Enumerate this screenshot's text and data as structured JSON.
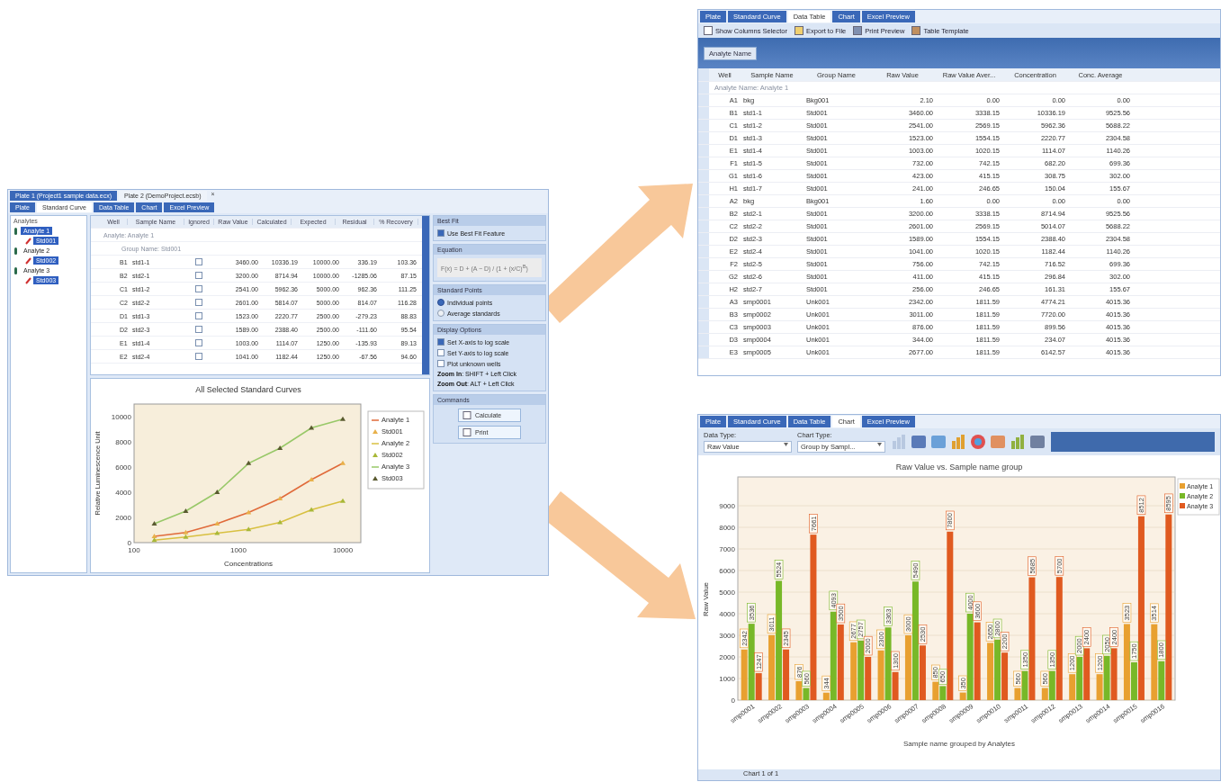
{
  "standard_curve_window": {
    "doc_tabs": [
      {
        "label": "Plate 1 (Project1 sample data.ecx)",
        "selected": true
      },
      {
        "label": "Plate 2 (DemoProject.ecsb)",
        "selected": false
      }
    ],
    "close_glyph": "×",
    "view_tabs": [
      {
        "label": "Plate",
        "selected": false
      },
      {
        "label": "Standard Curve",
        "selected": true
      },
      {
        "label": "Data Table",
        "selected": false
      },
      {
        "label": "Chart",
        "selected": false
      },
      {
        "label": "Excel Preview",
        "selected": false
      }
    ],
    "analytes_panel": {
      "title": "Analytes",
      "tree": [
        {
          "label": "Analyte 1",
          "selected": true,
          "children": [
            {
              "label": "Std001",
              "selected": true
            }
          ]
        },
        {
          "label": "Analyte 2",
          "selected": false,
          "children": [
            {
              "label": "Std002",
              "selected": true
            }
          ]
        },
        {
          "label": "Analyte 3",
          "selected": false,
          "children": [
            {
              "label": "Std003",
              "selected": true
            }
          ]
        }
      ]
    },
    "grid": {
      "columns": [
        "Well",
        "Sample Name",
        "Ignored",
        "Raw Value",
        "Calculated",
        "Expected",
        "Residual",
        "% Recovery"
      ],
      "group_rows": [
        "Analyte: Analyte 1",
        "Group Name: Std001"
      ],
      "rows": [
        {
          "well": "B1",
          "sample": "std1-1",
          "ignored": false,
          "values": [
            "3460.00",
            "10336.19",
            "10000.00",
            "336.19",
            "103.36"
          ]
        },
        {
          "well": "B2",
          "sample": "std2-1",
          "ignored": false,
          "values": [
            "3200.00",
            "8714.94",
            "10000.00",
            "-1285.06",
            "87.15"
          ]
        },
        {
          "well": "C1",
          "sample": "std1-2",
          "ignored": false,
          "values": [
            "2541.00",
            "5962.36",
            "5000.00",
            "962.36",
            "111.25"
          ]
        },
        {
          "well": "C2",
          "sample": "std2-2",
          "ignored": false,
          "values": [
            "2601.00",
            "5814.07",
            "5000.00",
            "814.07",
            "116.28"
          ]
        },
        {
          "well": "D1",
          "sample": "std1-3",
          "ignored": false,
          "values": [
            "1523.00",
            "2220.77",
            "2500.00",
            "-279.23",
            "88.83"
          ]
        },
        {
          "well": "D2",
          "sample": "std2-3",
          "ignored": false,
          "values": [
            "1589.00",
            "2388.40",
            "2500.00",
            "-111.60",
            "95.54"
          ]
        },
        {
          "well": "E1",
          "sample": "std1-4",
          "ignored": false,
          "values": [
            "1003.00",
            "1114.07",
            "1250.00",
            "-135.93",
            "89.13"
          ]
        },
        {
          "well": "E2",
          "sample": "std2-4",
          "ignored": false,
          "values": [
            "1041.00",
            "1182.44",
            "1250.00",
            "-67.56",
            "94.60"
          ]
        }
      ]
    },
    "curve_chart": {
      "chart_data": {
        "type": "line",
        "title": "All Selected Standard Curves",
        "xlabel": "Concentrations",
        "ylabel": "Relative Luminescence Unit",
        "categories": [
          null,
          null,
          null,
          null,
          null,
          null,
          null
        ],
        "legend": "right",
        "ylim": [
          0,
          11000
        ],
        "yticks": [
          0,
          2000,
          4000,
          6000,
          8000,
          10000
        ],
        "series": [
          {
            "name": "Analyte 1",
            "type": "line",
            "color": "#e06a3a",
            "values": [
              500,
              800,
              1500,
              2400,
              3500,
              5000,
              6300
            ]
          },
          {
            "name": "Std001",
            "type": "scatter",
            "color": "#e8b04a",
            "values": [
              500,
              800,
              1500,
              2400,
              3500,
              5000,
              6300
            ]
          },
          {
            "name": "Analyte 2",
            "type": "line",
            "color": "#d8c040",
            "values": [
              200,
              450,
              750,
              1050,
              1600,
              2600,
              3300
            ]
          },
          {
            "name": "Std002",
            "type": "scatter",
            "color": "#a8b838",
            "values": [
              200,
              450,
              750,
              1050,
              1600,
              2600,
              3300
            ]
          },
          {
            "name": "Analyte 3",
            "type": "line",
            "color": "#98c868",
            "values": [
              1500,
              2500,
              4000,
              6300,
              7500,
              9100,
              9800
            ]
          },
          {
            "name": "Std003",
            "type": "scatter",
            "color": "#5a5a30",
            "values": [
              1500,
              2500,
              4000,
              6300,
              7500,
              9100,
              9800
            ]
          }
        ]
      },
      "x_axis_labels": [
        "100",
        "1000",
        "10000"
      ]
    },
    "panels": [
      {
        "title": "Best Fit",
        "kind": "checks",
        "items": [
          {
            "label": "Use Best Fit Feature",
            "checked": true
          }
        ]
      },
      {
        "title": "Equation",
        "kind": "equation",
        "equation": "F(x) = D + (A − D) / (1 + (x/C)$^{B}$)"
      },
      {
        "title": "Standard Points",
        "kind": "radios",
        "items": [
          {
            "label": "Individual points",
            "selected": true
          },
          {
            "label": "Average standards",
            "selected": false
          }
        ]
      },
      {
        "title": "Display Options",
        "kind": "checks",
        "items": [
          {
            "label": "Set X-axis to log scale",
            "checked": true
          },
          {
            "label": "Set Y-axis to log scale",
            "checked": false
          },
          {
            "label": "Plot unknown wells",
            "checked": false
          }
        ],
        "notes": [
          "**Zoom In**: SHIFT + Left Click",
          "**Zoom Out**: ALT + Left Click"
        ]
      },
      {
        "title": "Commands",
        "kind": "buttons",
        "buttons": [
          "Calculate",
          "Print"
        ]
      }
    ]
  },
  "data_table_window": {
    "tabs": [
      {
        "label": "Plate",
        "selected": false
      },
      {
        "label": "Standard Curve",
        "selected": false
      },
      {
        "label": "Data Table",
        "selected": true
      },
      {
        "label": "Chart",
        "selected": false
      },
      {
        "label": "Excel Preview",
        "selected": false
      }
    ],
    "toolbar": [
      "Show Columns Selector",
      "Export to File",
      "Print Preview",
      "Table Template"
    ],
    "group_chip": "Analyte Name",
    "columns": [
      "Well",
      "Sample Name",
      "Group Name",
      "Raw Value",
      "Raw Value Aver...",
      "Concentration",
      "Conc. Average"
    ],
    "group_row": "Analyte Name: Analyte 1",
    "rows": [
      [
        "A1",
        "bkg",
        "Bkg001",
        "2.10",
        "0.00",
        "0.00",
        "0.00"
      ],
      [
        "B1",
        "std1-1",
        "Std001",
        "3460.00",
        "3338.15",
        "10336.19",
        "9525.56"
      ],
      [
        "C1",
        "std1-2",
        "Std001",
        "2541.00",
        "2569.15",
        "5962.36",
        "5688.22"
      ],
      [
        "D1",
        "std1-3",
        "Std001",
        "1523.00",
        "1554.15",
        "2220.77",
        "2304.58"
      ],
      [
        "E1",
        "std1-4",
        "Std001",
        "1003.00",
        "1020.15",
        "1114.07",
        "1140.26"
      ],
      [
        "F1",
        "std1-5",
        "Std001",
        "732.00",
        "742.15",
        "682.20",
        "699.36"
      ],
      [
        "G1",
        "std1-6",
        "Std001",
        "423.00",
        "415.15",
        "308.75",
        "302.00"
      ],
      [
        "H1",
        "std1-7",
        "Std001",
        "241.00",
        "246.65",
        "150.04",
        "155.67"
      ],
      [
        "A2",
        "bkg",
        "Bkg001",
        "1.60",
        "0.00",
        "0.00",
        "0.00"
      ],
      [
        "B2",
        "std2-1",
        "Std001",
        "3200.00",
        "3338.15",
        "8714.94",
        "9525.56"
      ],
      [
        "C2",
        "std2-2",
        "Std001",
        "2601.00",
        "2569.15",
        "5014.07",
        "5688.22"
      ],
      [
        "D2",
        "std2-3",
        "Std001",
        "1589.00",
        "1554.15",
        "2388.40",
        "2304.58"
      ],
      [
        "E2",
        "std2-4",
        "Std001",
        "1041.00",
        "1020.15",
        "1182.44",
        "1140.26"
      ],
      [
        "F2",
        "std2-5",
        "Std001",
        "756.00",
        "742.15",
        "716.52",
        "699.36"
      ],
      [
        "G2",
        "std2-6",
        "Std001",
        "411.00",
        "415.15",
        "296.84",
        "302.00"
      ],
      [
        "H2",
        "std2-7",
        "Std001",
        "256.00",
        "246.65",
        "161.31",
        "155.67"
      ],
      [
        "A3",
        "smp0001",
        "Unk001",
        "2342.00",
        "1811.59",
        "4774.21",
        "4015.36"
      ],
      [
        "B3",
        "smp0002",
        "Unk001",
        "3011.00",
        "1811.59",
        "7720.00",
        "4015.36"
      ],
      [
        "C3",
        "smp0003",
        "Unk001",
        "876.00",
        "1811.59",
        "899.56",
        "4015.36"
      ],
      [
        "D3",
        "smp0004",
        "Unk001",
        "344.00",
        "1811.59",
        "234.07",
        "4015.36"
      ],
      [
        "E3",
        "smp0005",
        "Unk001",
        "2677.00",
        "1811.59",
        "6142.57",
        "4015.36"
      ]
    ]
  },
  "chart_window": {
    "tabs": [
      {
        "label": "Plate",
        "selected": false
      },
      {
        "label": "Standard Curve",
        "selected": false
      },
      {
        "label": "Data Table",
        "selected": false
      },
      {
        "label": "Chart",
        "selected": true
      },
      {
        "label": "Excel Preview",
        "selected": false
      }
    ],
    "selectors": [
      {
        "label": "Data Type:",
        "value": "Raw Value"
      },
      {
        "label": "Chart Type:",
        "value": "Group by Sampl..."
      }
    ],
    "chart": {
      "chart_data": {
        "type": "bar",
        "title": "Raw Value vs. Sample name group",
        "xlabel": "Sample name grouped by Analytes",
        "ylabel": "Raw Value",
        "categories": [
          "smp0001",
          "smp0002",
          "smp0003",
          "smp0004",
          "smp0005",
          "smp0006",
          "smp0007",
          "smp0008",
          "smp0009",
          "smp0010",
          "smp0011",
          "smp0012",
          "smp0013",
          "smp0014",
          "smp0015",
          "smp0016"
        ],
        "ylim": [
          0,
          9500
        ],
        "yticks": [
          0,
          1000,
          2000,
          3000,
          4000,
          5000,
          6000,
          7000,
          8000,
          9000
        ],
        "data_labels": true,
        "grid": true,
        "legend": "right",
        "series": [
          {
            "name": "Analyte 1",
            "color": "#e8a030",
            "values": [
              2342,
              3011,
              876,
              344,
              2677,
              2300,
              3000,
              850,
              350,
              2650,
              560,
              560,
              1200,
              1200,
              3523,
              3514
            ]
          },
          {
            "name": "Analyte 2",
            "color": "#78b828",
            "values": [
              3536,
              5524,
              560,
              4093,
              2757,
              3363,
              5490,
              650,
              4000,
              2800,
              1350,
              1350,
              2000,
              2050,
              1750,
              1800
            ]
          },
          {
            "name": "Analyte 3",
            "color": "#e05a20",
            "values": [
              1247,
              2345,
              7661,
              3500,
              2000,
              1300,
              2530,
              7800,
              3600,
              2200,
              5685,
              5700,
              2400,
              2400,
              8512,
              8595
            ]
          }
        ]
      }
    },
    "status": "Chart 1 of 1"
  }
}
